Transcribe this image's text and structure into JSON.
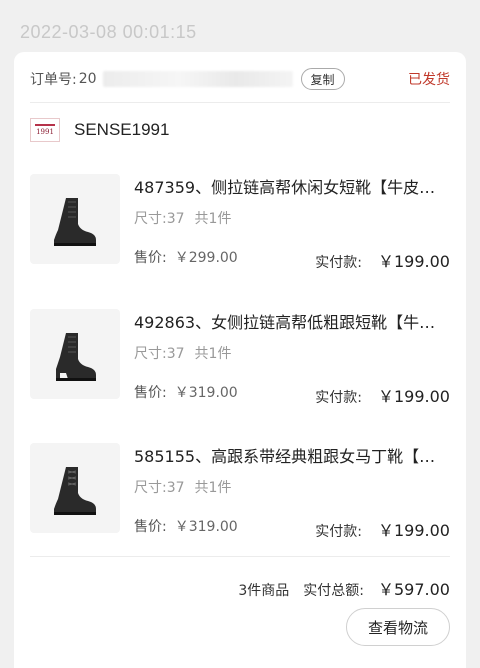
{
  "timestamp": "2022-03-08 00:01:15",
  "order": {
    "label": "订单号:",
    "number_prefix": "20",
    "copy_label": "复制",
    "status": "已发货",
    "status_color": "#c0392b"
  },
  "shop": {
    "name": "SENSE1991",
    "logo_text": "1991"
  },
  "items": [
    {
      "title": "487359、侧拉链高帮休闲女短靴【牛皮…",
      "size": "尺寸:37",
      "qty": "共1件",
      "price_label": "售价:",
      "price": "￥299.00",
      "paid_label": "实付款:",
      "paid": "￥199.00",
      "image_icon": "ankle-boot-icon"
    },
    {
      "title": "492863、女侧拉链高帮低粗跟短靴【牛…",
      "size": "尺寸:37",
      "qty": "共1件",
      "price_label": "售价:",
      "price": "￥319.00",
      "paid_label": "实付款:",
      "paid": "￥199.00",
      "image_icon": "ankle-boot-icon"
    },
    {
      "title": "585155、高跟系带经典粗跟女马丁靴【…",
      "size": "尺寸:37",
      "qty": "共1件",
      "price_label": "售价:",
      "price": "￥319.00",
      "paid_label": "实付款:",
      "paid": "￥199.00",
      "image_icon": "ankle-boot-icon"
    }
  ],
  "summary": {
    "count": "3件商品",
    "total_label": "实付总额:",
    "total": "￥597.00"
  },
  "actions": {
    "logistics_label": "查看物流"
  }
}
